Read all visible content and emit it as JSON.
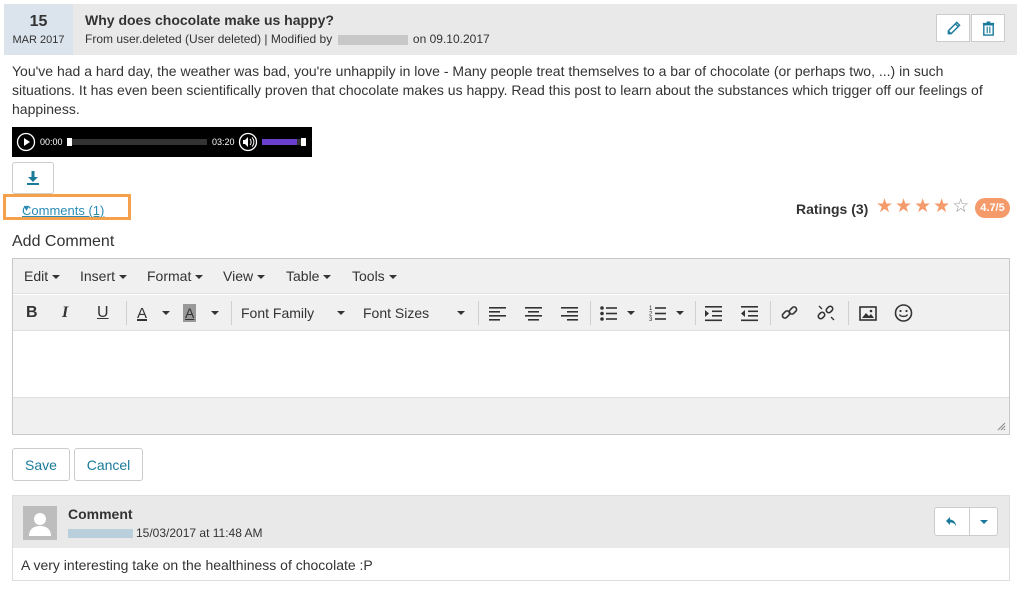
{
  "post": {
    "day": "15",
    "month": "MAR 2017",
    "title": "Why does chocolate make us happy?",
    "meta_prefix": "From user.deleted (User deleted) | Modified by",
    "meta_suffix": "on 09.10.2017",
    "body": "You've had a hard day, the weather was bad, you're unhappily in love - Many people treat themselves to a bar of chocolate (or perhaps two, ...) in such situations. It has even been scientifically proven that chocolate makes us happy. Read this post to learn about the substances which trigger off our feelings of happiness.",
    "edit_icon": "pencil-icon",
    "delete_icon": "trash-icon"
  },
  "audio": {
    "current_time": "00:00",
    "duration": "03:20",
    "progress": 0,
    "volume": 0.8
  },
  "comments_toggle": "Comments (1)",
  "ratings": {
    "label": "Ratings (3)",
    "value": 4.7,
    "max": 5,
    "badge": "4.7/5"
  },
  "add_comment": "Add Comment",
  "editor": {
    "menus": [
      "Edit",
      "Insert",
      "Format",
      "View",
      "Table",
      "Tools"
    ],
    "font_family": "Font Family",
    "font_sizes": "Font Sizes",
    "bold": "B",
    "italic": "I",
    "underline": "U",
    "text_color": "A",
    "bg_color": "A"
  },
  "actions": {
    "save": "Save",
    "cancel": "Cancel"
  },
  "comment": {
    "title": "Comment",
    "timestamp": "15/03/2017 at 11:48 AM",
    "text": "A very interesting take on the healthiness of chocolate :P"
  },
  "colors": {
    "accent": "#1a7a9a",
    "rating": "#f59a6b",
    "highlight": "#f5a04d",
    "volume": "#6a3fd0"
  }
}
